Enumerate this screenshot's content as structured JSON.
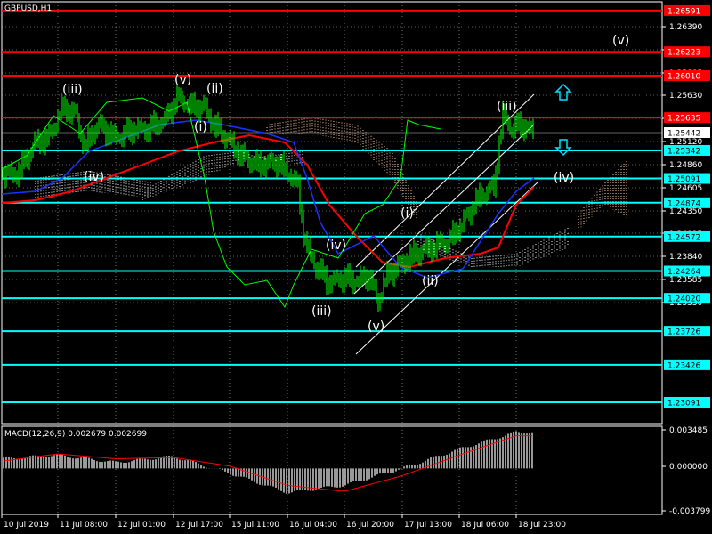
{
  "window": {
    "symbol_label": "GBPUSD,H1"
  },
  "colors": {
    "background": "#000000",
    "grid": "#c0c0c0",
    "price_line_green": "#00ff00",
    "red_level": "#ff0000",
    "cyan_level": "#00ffff",
    "red_ma": "#ff0000",
    "blue_ma": "#1a32ff",
    "cloud_bear": "#ffc8a0",
    "cloud_bull": "#ffffff",
    "macd_bars": "#c0c0c0",
    "macd_signal": "#ff0000",
    "arrow_cyan": "#00e0ff"
  },
  "price_axis": {
    "ticks": [
      "1.26390",
      "1.26135",
      "1.25885",
      "1.25630",
      "1.25375",
      "1.25120",
      "1.24860",
      "1.24605",
      "1.24350",
      "1.24095",
      "1.23840",
      "1.23585",
      "1.23330"
    ],
    "current_price": "1.25442"
  },
  "levels": [
    {
      "label": "1.26591",
      "value": 1.26591,
      "color": "red"
    },
    {
      "label": "1.26223",
      "value": 1.26223,
      "color": "red"
    },
    {
      "label": "1.26010",
      "value": 1.2601,
      "color": "red"
    },
    {
      "label": "1.25635",
      "value": 1.25635,
      "color": "red"
    },
    {
      "label": "1.25342",
      "value": 1.25342,
      "color": "cyan"
    },
    {
      "label": "1.25091",
      "value": 1.25091,
      "color": "cyan"
    },
    {
      "label": "1.24874",
      "value": 1.24874,
      "color": "cyan"
    },
    {
      "label": "1.24572",
      "value": 1.24572,
      "color": "cyan"
    },
    {
      "label": "1.24264",
      "value": 1.24264,
      "color": "cyan"
    },
    {
      "label": "1.24020",
      "value": 1.2402,
      "color": "cyan"
    },
    {
      "label": "1.23726",
      "value": 1.23726,
      "color": "cyan"
    },
    {
      "label": "1.23426",
      "value": 1.23426,
      "color": "cyan"
    },
    {
      "label": "1.23091",
      "value": 1.23091,
      "color": "cyan"
    }
  ],
  "time_axis": [
    "10 Jul 2019",
    "11 Jul 08:00",
    "12 Jul 01:00",
    "12 Jul 17:00",
    "15 Jul 11:00",
    "16 Jul 04:00",
    "16 Jul 20:00",
    "17 Jul 13:00",
    "18 Jul 06:00",
    "18 Jul 23:00"
  ],
  "wave_labels": [
    "(iii)",
    "(iv)",
    "(v)",
    "(ii)",
    "(i)",
    "(iii)",
    "(iv)",
    "(v)",
    "(i)",
    "(ii)",
    "(iii)",
    "(iv)",
    "(v)"
  ],
  "macd": {
    "label": "MACD(12,26,9) 0.002679 0.002699",
    "axis_ticks": [
      "0.003485",
      "0.000000",
      "-0.003799"
    ]
  },
  "chart_data": {
    "type": "line",
    "symbol": "GBPUSD",
    "timeframe": "H1",
    "x": [
      "10 Jul 2019",
      "11 Jul 08:00",
      "12 Jul 01:00",
      "12 Jul 17:00",
      "15 Jul 11:00",
      "16 Jul 04:00",
      "16 Jul 20:00",
      "17 Jul 13:00",
      "18 Jul 06:00",
      "18 Jul 23:00"
    ],
    "series": [
      {
        "values": [
          1.2505,
          1.2555,
          1.255,
          1.2575,
          1.2515,
          1.2408,
          1.2395,
          1.243,
          1.247,
          1.2544
        ]
      }
    ],
    "ylim": [
      1.229,
      1.2667
    ],
    "horizontal_levels": [
      1.26591,
      1.26223,
      1.2601,
      1.25635,
      1.25342,
      1.25091,
      1.24874,
      1.24572,
      1.24264,
      1.2402,
      1.23726,
      1.23426,
      1.23091
    ],
    "grid": true,
    "indicator": {
      "type": "bar",
      "macd_ylim": [
        -0.003799,
        0.003485
      ],
      "macd_values": [
        0.0008,
        0.0011,
        0.0005,
        0.001,
        -0.0004,
        -0.002,
        -0.0014,
        0.0,
        0.0016,
        0.003
      ],
      "signal_values": [
        0.0006,
        0.0012,
        0.0008,
        0.0009,
        0.0002,
        -0.0014,
        -0.0019,
        -0.0006,
        0.0011,
        0.0027
      ]
    }
  }
}
